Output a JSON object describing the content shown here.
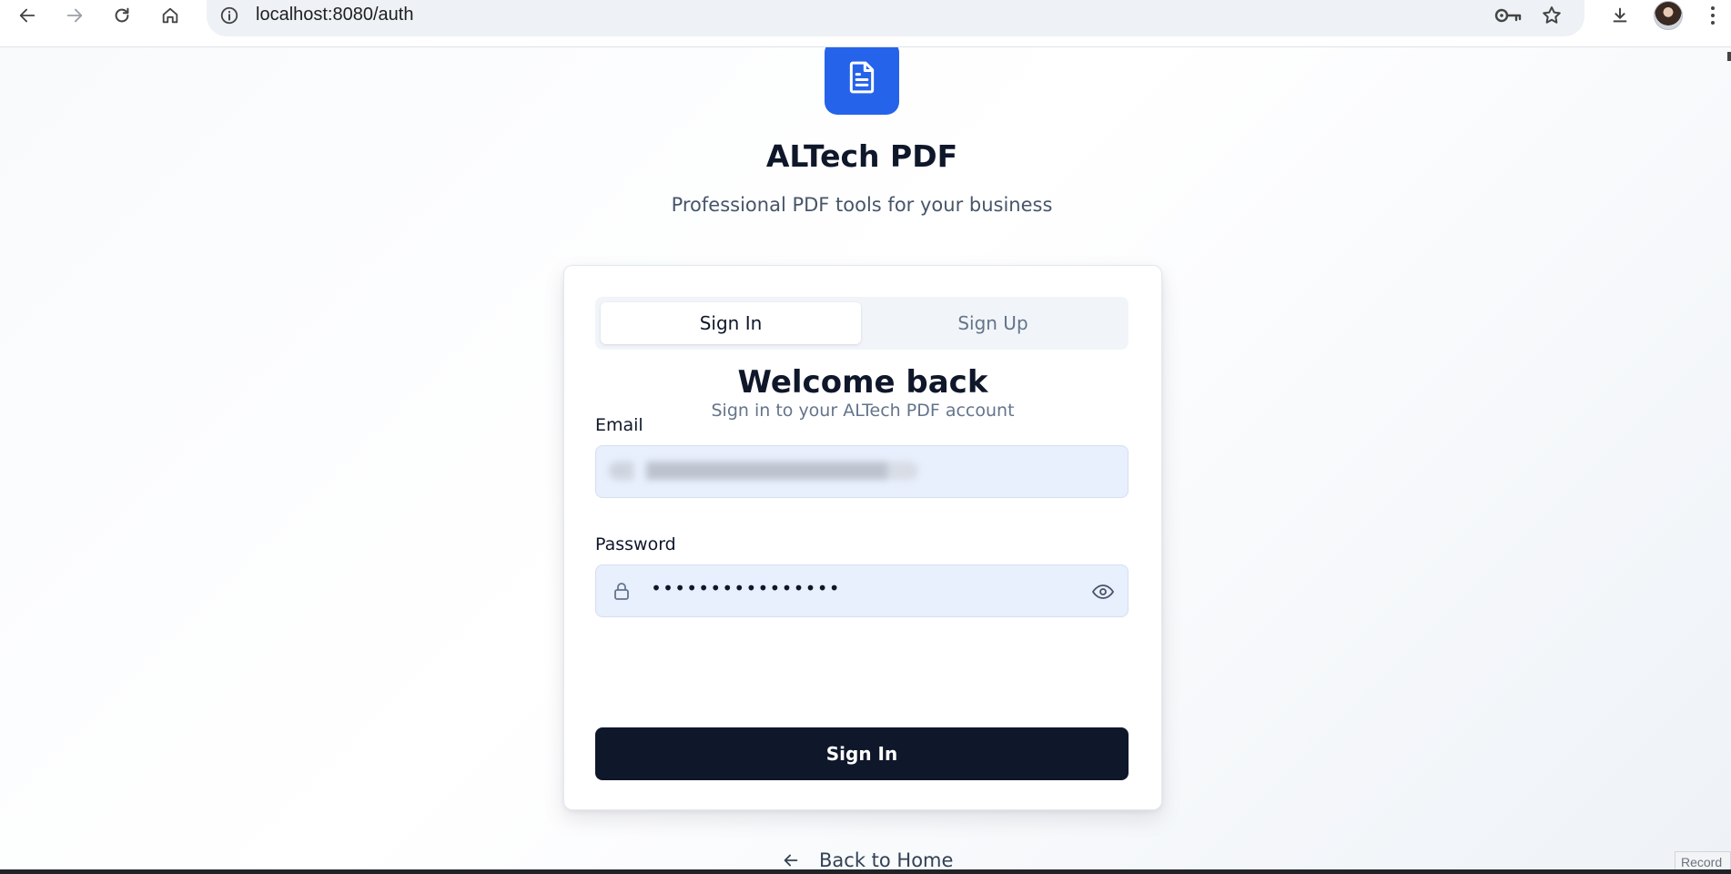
{
  "browser": {
    "url": "localhost:8080/auth",
    "icons": [
      "back-icon",
      "forward-icon",
      "reload-icon",
      "home-icon",
      "info-icon",
      "key-icon",
      "star-icon",
      "download-icon",
      "profile-avatar",
      "menu-icon"
    ]
  },
  "brand": {
    "title": "ALTech PDF",
    "subtitle": "Professional PDF tools for your business",
    "logo_icon": "document-icon",
    "accent_color": "#2563eb"
  },
  "auth": {
    "tabs": [
      {
        "label": "Sign In",
        "active": true
      },
      {
        "label": "Sign Up",
        "active": false
      }
    ],
    "heading": "Welcome back",
    "subheading": "Sign in to your ALTech PDF account",
    "email": {
      "label": "Email",
      "value": ""
    },
    "password": {
      "label": "Password",
      "value": "••••••••••••••••"
    },
    "submit_label": "Sign In",
    "submit_color": "#0f172a"
  },
  "footer": {
    "back_label": "Back to Home"
  },
  "overlay": {
    "record_label": "Record"
  }
}
